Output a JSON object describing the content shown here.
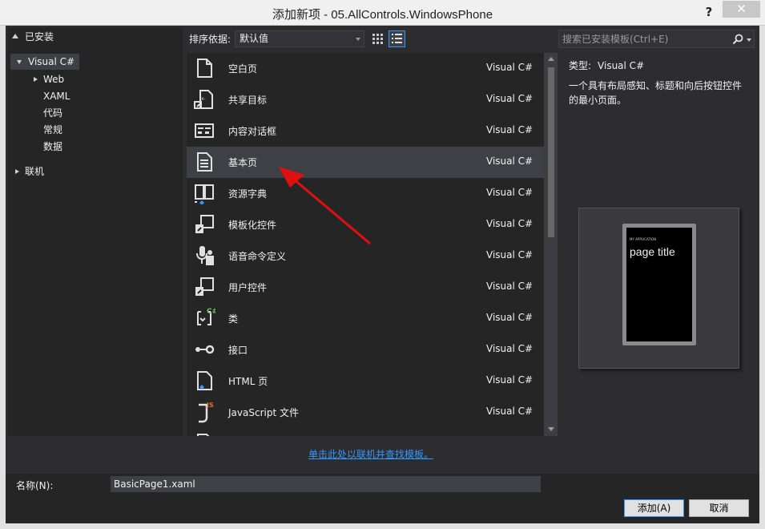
{
  "window": {
    "title": "添加新项 - 05.AllControls.WindowsPhone",
    "help": "?",
    "close": "✕"
  },
  "left": {
    "installed": "已安装",
    "tree": [
      {
        "label": "Visual C#"
      },
      {
        "label": "Web"
      },
      {
        "label": "XAML"
      },
      {
        "label": "代码"
      },
      {
        "label": "常规"
      },
      {
        "label": "数据"
      },
      {
        "label": "联机"
      }
    ]
  },
  "toolbar": {
    "sort_label": "排序依据:",
    "sort_value": "默认值",
    "search_placeholder": "搜索已安装模板(Ctrl+E)"
  },
  "templates": [
    {
      "name": "空白页",
      "lang": "Visual C#",
      "icon": "blank-page-icon"
    },
    {
      "name": "共享目标",
      "lang": "Visual C#",
      "icon": "share-target-icon"
    },
    {
      "name": "内容对话框",
      "lang": "Visual C#",
      "icon": "content-dialog-icon"
    },
    {
      "name": "基本页",
      "lang": "Visual C#",
      "icon": "basic-page-icon",
      "selected": true
    },
    {
      "name": "资源字典",
      "lang": "Visual C#",
      "icon": "resource-dictionary-icon"
    },
    {
      "name": "模板化控件",
      "lang": "Visual C#",
      "icon": "templated-control-icon"
    },
    {
      "name": "语音命令定义",
      "lang": "Visual C#",
      "icon": "voice-command-icon"
    },
    {
      "name": "用户控件",
      "lang": "Visual C#",
      "icon": "user-control-icon"
    },
    {
      "name": "类",
      "lang": "Visual C#",
      "icon": "class-icon"
    },
    {
      "name": "接口",
      "lang": "Visual C#",
      "icon": "interface-icon"
    },
    {
      "name": "HTML 页",
      "lang": "Visual C#",
      "icon": "html-page-icon"
    },
    {
      "name": "JavaScript 文件",
      "lang": "Visual C#",
      "icon": "javascript-file-icon"
    }
  ],
  "info": {
    "type_label": "类型:",
    "type_value": "Visual C#",
    "description": "一个具有布局感知、标题和向后按钮控件的最小页面。",
    "preview_app": "MY APPLICATION",
    "preview_title": "page title"
  },
  "online_link": "单击此处以联机并查找模板。",
  "bottom": {
    "name_label": "名称(N):",
    "name_value": "BasicPage1.xaml",
    "add": "添加(A)",
    "cancel": "取消"
  },
  "colors": {
    "background": "#2d2d30",
    "panel": "#252526",
    "selected": "#3f3f46",
    "link": "#3399ff",
    "arrow": "#e01010"
  }
}
